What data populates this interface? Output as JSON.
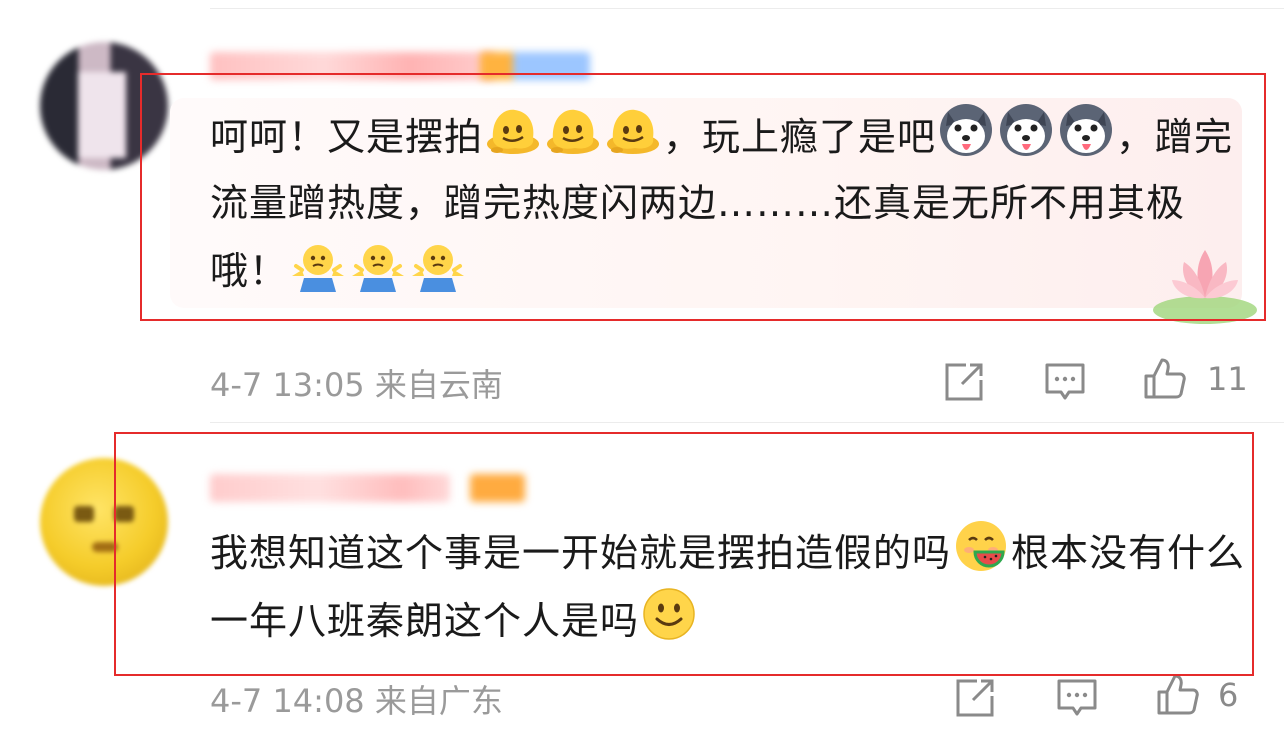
{
  "comments": [
    {
      "name": "",
      "text_parts": [
        "呵呵！又是摆拍",
        "[melt]",
        "[melt]",
        "[melt]",
        "，玩上瘾了是吧",
        "[husky]",
        "[husky]",
        "[husky]",
        "，蹭完流量蹭热度，蹭完热度闪两边………还真是无所不用其极哦！",
        "[shrug]",
        "[shrug]",
        "[shrug]"
      ],
      "time": "4-7 13:05",
      "location": "来自云南",
      "likes": "11"
    },
    {
      "name": "",
      "text_parts": [
        "我想知道这个事是一开始就是摆拍造假的吗",
        "[eatmelon]",
        "根本没有什么一年八班秦朗这个人是吗",
        "[smile]"
      ],
      "time": "4-7 14:08",
      "location": "来自广东",
      "likes": "6"
    }
  ],
  "icons": {
    "share": "share-icon",
    "comment": "comment-icon",
    "like": "thumbs-up-icon",
    "emoji": [
      "melting-face-emoji",
      "husky-dog-emoji",
      "shrug-emoji",
      "eating-melon-emoji",
      "smile-emoji"
    ]
  },
  "colors": {
    "highlight_box": "#e52b2b",
    "meta_text": "#9a9a9a",
    "bubble_bg": "#fff5f3"
  }
}
